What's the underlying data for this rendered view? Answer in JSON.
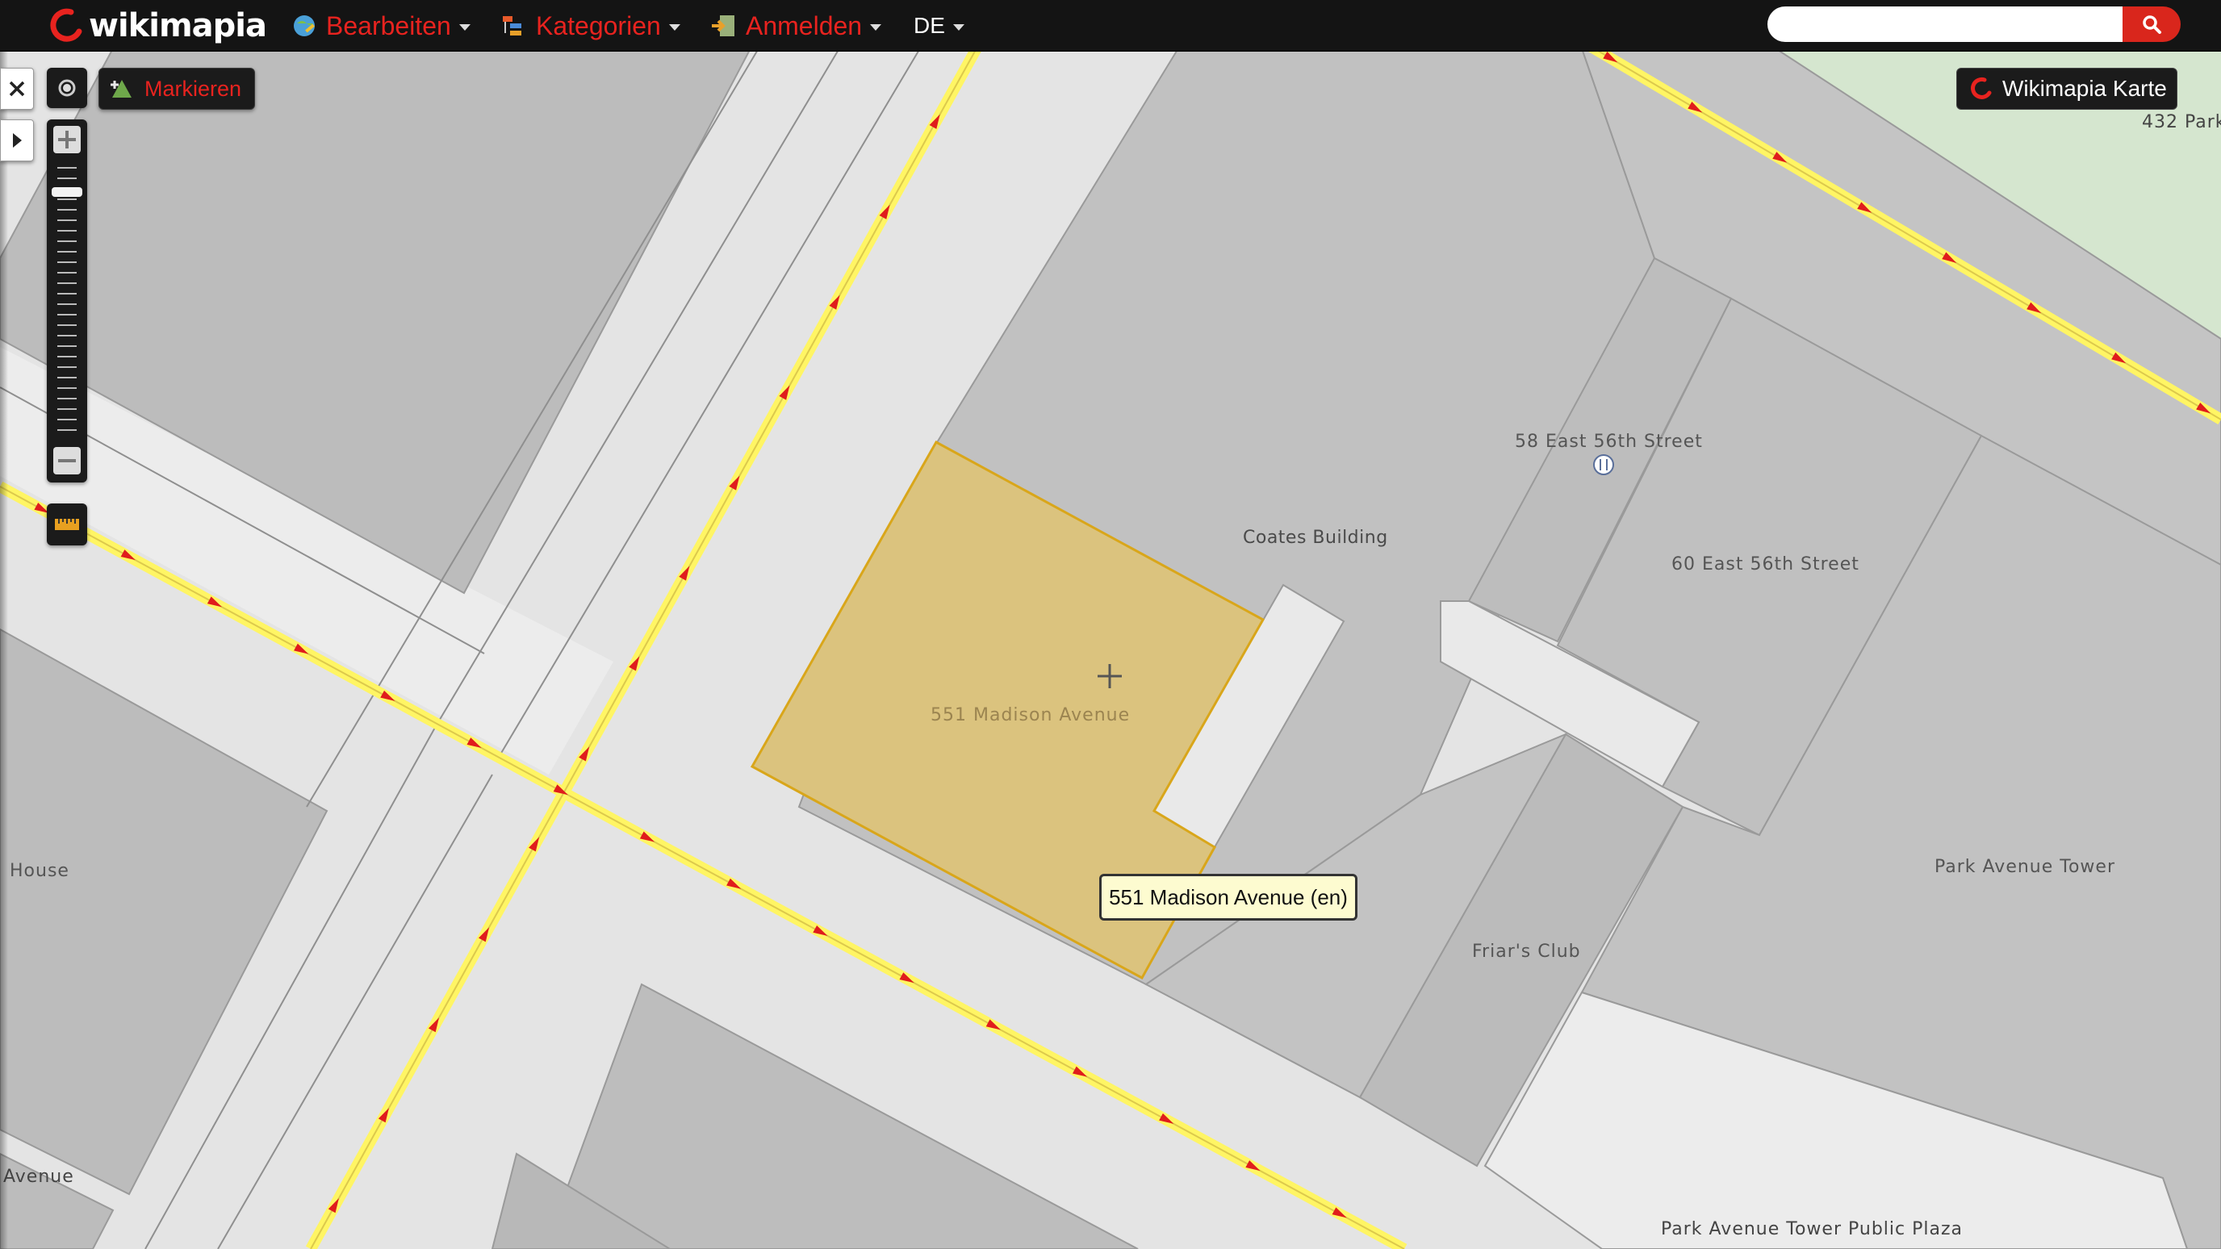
{
  "header": {
    "logo_text": "wikimapia",
    "menus": [
      {
        "label": "Bearbeiten",
        "icon": "globe-edit-icon"
      },
      {
        "label": "Kategorien",
        "icon": "categories-icon"
      },
      {
        "label": "Anmelden",
        "icon": "login-icon"
      }
    ],
    "language": "DE",
    "search": {
      "value": "",
      "placeholder": "",
      "icon": "search-icon"
    }
  },
  "controls": {
    "close_icon": "close-icon",
    "expand_icon": "play-arrow-icon",
    "locate_icon": "locate-icon",
    "mark_label": "Markieren",
    "zoom_in_icon": "plus-icon",
    "zoom_out_icon": "minus-icon",
    "ruler_icon": "ruler-icon",
    "map_type_label": "Wikimapia Karte"
  },
  "map": {
    "selected_place": "551 Madison Avenue",
    "tooltip": "551 Madison Avenue (en)",
    "labels": {
      "coates": "Coates Building",
      "e58": "58 East 56th Street",
      "e60": "60 East 56th Street",
      "friars": "Friar's Club",
      "park_tower": "Park Avenue Tower",
      "plaza": "Park Avenue Tower Public Plaza",
      "park432": "432 Park",
      "house": "House",
      "avenue": "Avenue"
    },
    "colors": {
      "road": "#fff564",
      "road_arrow": "#e01c1c",
      "building": "#bdbdbd",
      "selected": "#dcc27f",
      "park": "#d5e7d0"
    }
  }
}
